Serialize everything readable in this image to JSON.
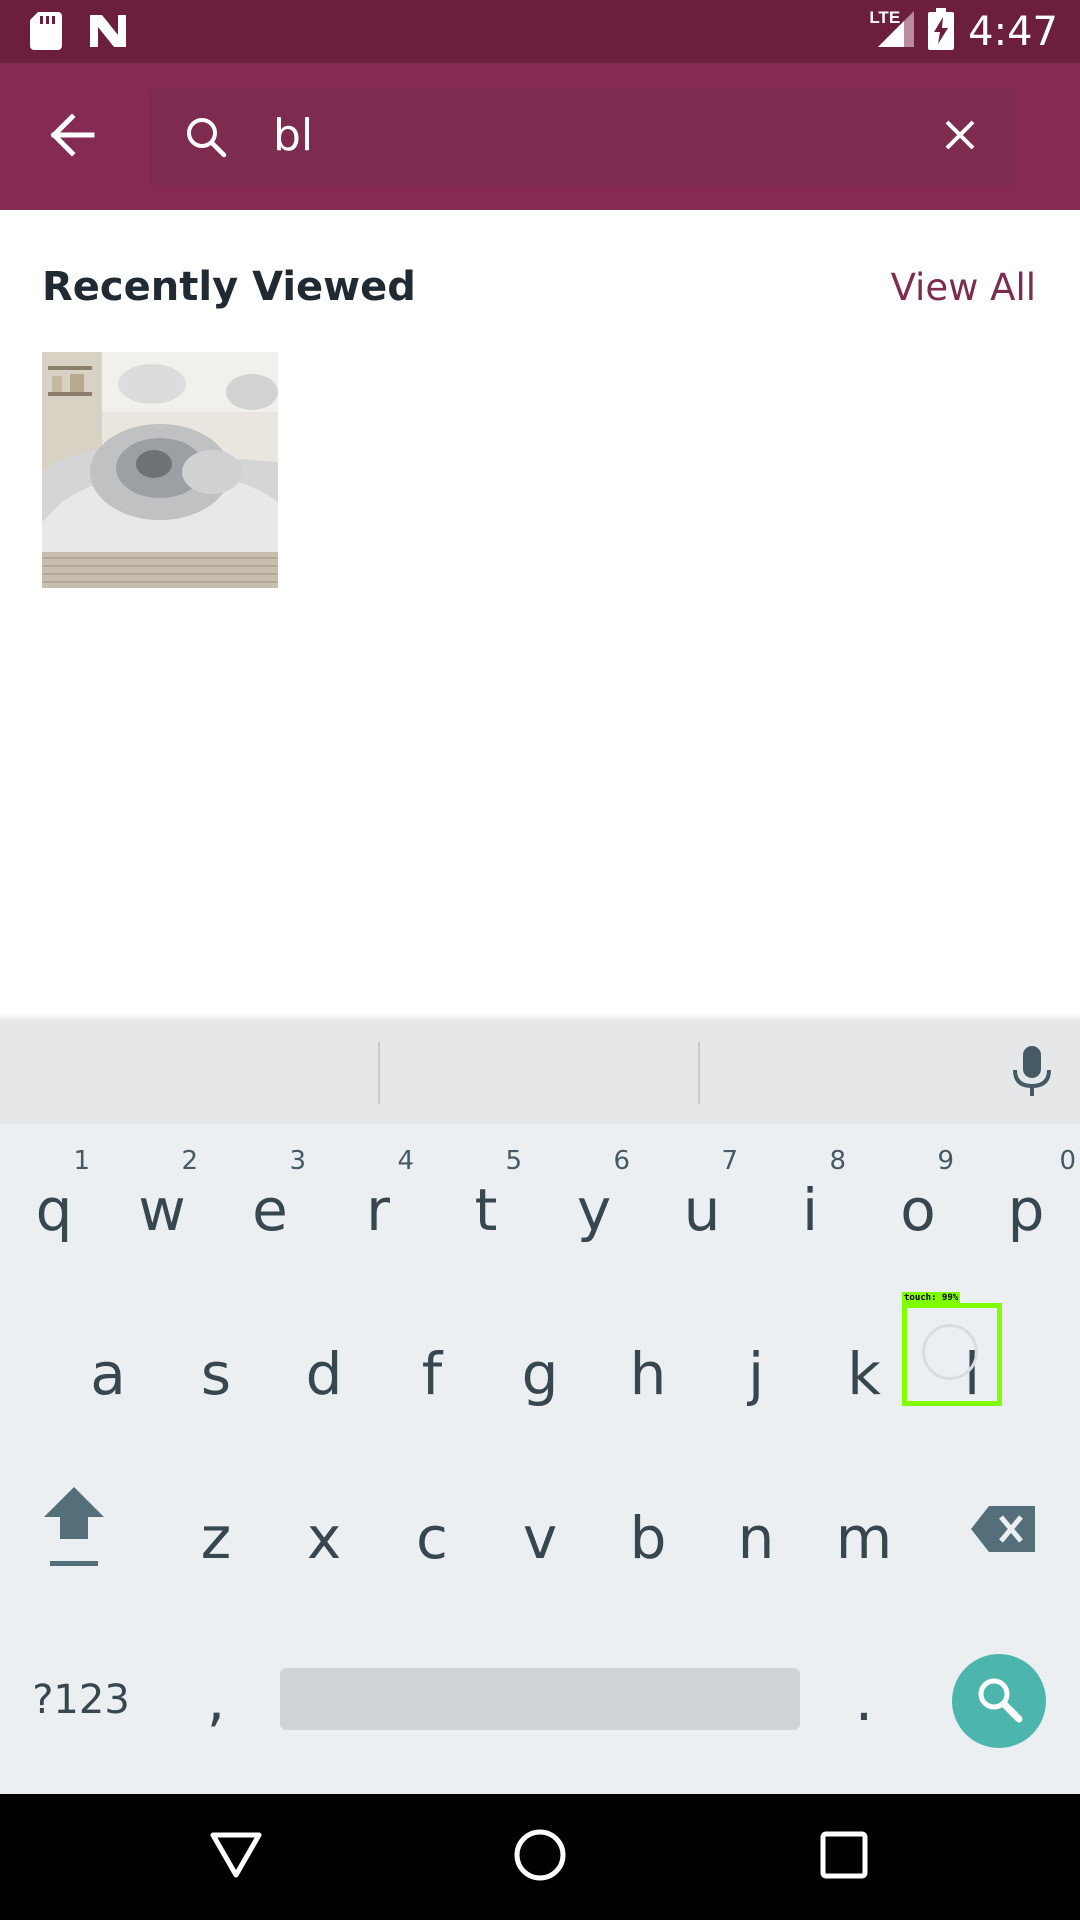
{
  "status_bar": {
    "time": "4:47",
    "network": "LTE",
    "icons": [
      "sd-card-icon",
      "n-notification-icon",
      "signal-icon",
      "battery-charging-icon"
    ]
  },
  "toolbar": {
    "back_icon": "arrow-left-icon",
    "search_icon": "search-icon",
    "search_value": "bl",
    "clear_icon": "close-icon"
  },
  "recently_viewed": {
    "title": "Recently Viewed",
    "view_all": "View All",
    "items": [
      {
        "image": "wolf-bedding-thumbnail"
      }
    ]
  },
  "keyboard": {
    "row1": [
      {
        "key": "q",
        "hint": "1"
      },
      {
        "key": "w",
        "hint": "2"
      },
      {
        "key": "e",
        "hint": "3"
      },
      {
        "key": "r",
        "hint": "4"
      },
      {
        "key": "t",
        "hint": "5"
      },
      {
        "key": "y",
        "hint": "6"
      },
      {
        "key": "u",
        "hint": "7"
      },
      {
        "key": "i",
        "hint": "8"
      },
      {
        "key": "o",
        "hint": "9"
      },
      {
        "key": "p",
        "hint": "0"
      }
    ],
    "row2": [
      "a",
      "s",
      "d",
      "f",
      "g",
      "h",
      "j",
      "k",
      "l"
    ],
    "row3": [
      "z",
      "x",
      "c",
      "v",
      "b",
      "n",
      "m"
    ],
    "symbols_label": "?123",
    "comma": ",",
    "period": ".",
    "touch_label": "touch: 99%",
    "colors": {
      "action": "#4db6ac",
      "touch_box": "#7fff00"
    }
  },
  "colors": {
    "status_bar": "#6b1f3d",
    "toolbar": "#852a52",
    "accent": "#7d2c4f"
  }
}
